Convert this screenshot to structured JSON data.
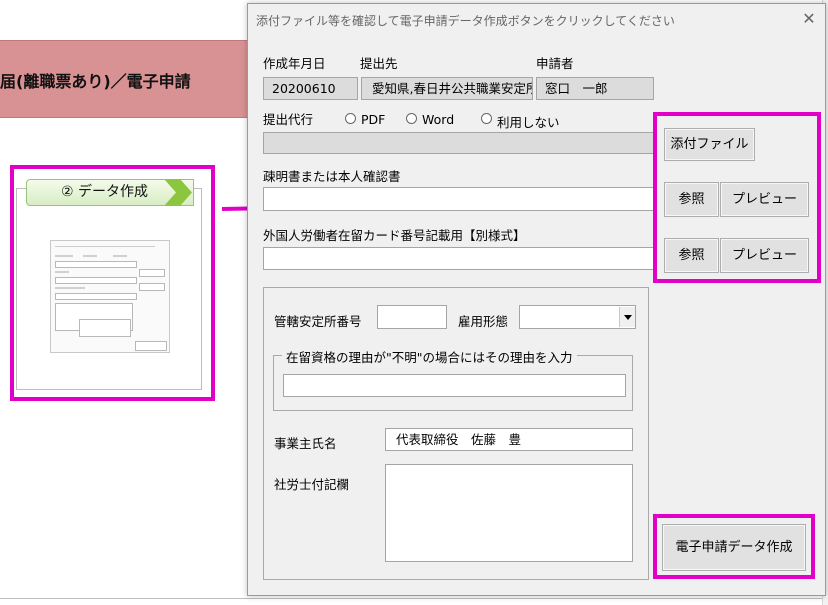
{
  "background": {
    "banner_title": "届(離職票あり)／電子申請"
  },
  "step_card": {
    "label": "② データ作成"
  },
  "dialog": {
    "title": "添付ファイル等を確認して電子申請データ作成ボタンをクリックしてください",
    "close_label": "✕",
    "header": {
      "date_label": "作成年月日",
      "recipient_label": "提出先",
      "applicant_label": "申請者",
      "date_value": "20200610",
      "recipient_value": "愛知県,春日井公共職業安定所",
      "applicant_value": "窓口　一郎"
    },
    "proxy": {
      "label": "提出代行",
      "options": [
        "PDF",
        "Word",
        "利用しない"
      ]
    },
    "attach_button": "添付ファイル",
    "doc1": {
      "label": "疎明書または本人確認書",
      "browse": "参照",
      "preview": "プレビュー"
    },
    "doc2": {
      "label": "外国人労働者在留カード番号記載用【別様式】",
      "browse": "参照",
      "preview": "プレビュー"
    },
    "office_number_label": "管轄安定所番号",
    "employment_type_label": "雇用形態",
    "residence_group_label": "在留資格の理由が\"不明\"の場合にはその理由を入力",
    "employer_label": "事業主氏名",
    "employer_value": "代表取締役　佐藤　豊",
    "notes_label": "社労士付記欄",
    "create_button": "電子申請データ作成"
  },
  "colors": {
    "highlight": "#e000c8",
    "banner": "#d99294",
    "tab_green": "#8cc63f"
  }
}
